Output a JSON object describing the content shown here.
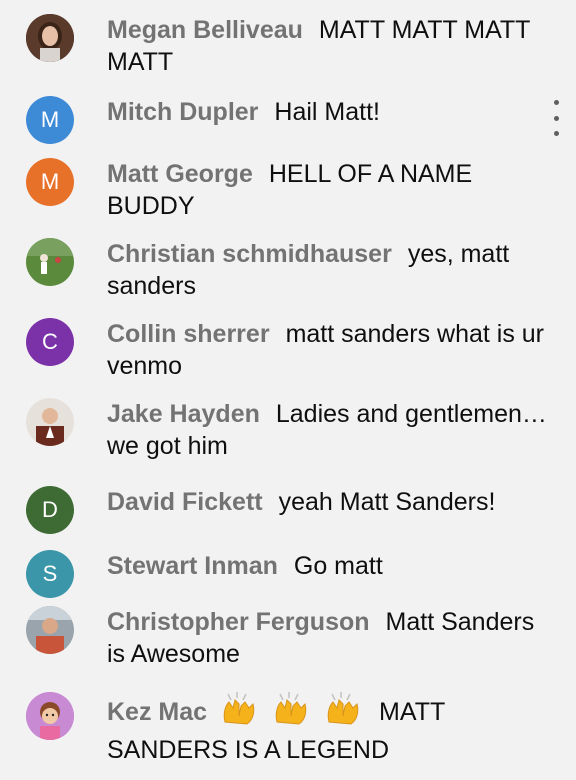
{
  "chat": {
    "menu_icon": "more-vert-icon",
    "messages": [
      {
        "author": "Megan Belliveau",
        "text": "MATT MATT MATT MATT",
        "avatar": {
          "type": "photo",
          "description_icon": "person-photo-icon"
        }
      },
      {
        "author": "Mitch Dupler",
        "text": "Hail Matt!",
        "avatar": {
          "type": "letter",
          "letter": "M",
          "color": "#3d8ad7"
        }
      },
      {
        "author": "Matt George",
        "text": "HELL OF A NAME BUDDY",
        "avatar": {
          "type": "letter",
          "letter": "M",
          "color": "#e8712a"
        }
      },
      {
        "author": "Christian schmidhauser",
        "text": "yes, matt sanders",
        "avatar": {
          "type": "photo",
          "description_icon": "field-photo-icon"
        }
      },
      {
        "author": "Collin sherrer",
        "text": "matt sanders what is ur venmo",
        "avatar": {
          "type": "letter",
          "letter": "C",
          "color": "#7b32a8"
        }
      },
      {
        "author": "Jake Hayden",
        "text": "Ladies and gentlemen… we got him",
        "avatar": {
          "type": "photo",
          "description_icon": "person-suit-photo-icon"
        }
      },
      {
        "author": "David Fickett",
        "text": "yeah Matt Sanders!",
        "avatar": {
          "type": "letter",
          "letter": "D",
          "color": "#3e6b33"
        }
      },
      {
        "author": "Stewart Inman",
        "text": "Go matt",
        "avatar": {
          "type": "letter",
          "letter": "S",
          "color": "#3a96a8"
        }
      },
      {
        "author": "Christopher Ferguson",
        "text": "Matt Sanders is Awesome",
        "avatar": {
          "type": "photo",
          "description_icon": "person-stadium-photo-icon"
        }
      },
      {
        "author": "Kez Mac",
        "text": "MATT SANDERS IS A LEGEND",
        "emoji": "raising-hands-emoji",
        "emoji_count": 3,
        "avatar": {
          "type": "photo",
          "description_icon": "cartoon-avatar-icon"
        }
      }
    ]
  }
}
